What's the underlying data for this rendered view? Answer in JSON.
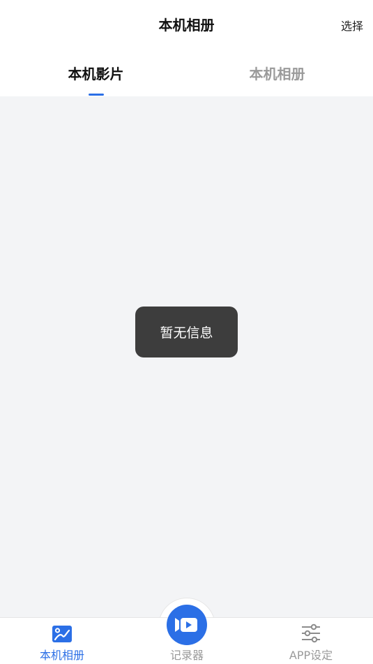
{
  "header": {
    "title": "本机相册",
    "action_label": "选择"
  },
  "tabs": [
    {
      "label": "本机影片",
      "active": true
    },
    {
      "label": "本机相册",
      "active": false
    }
  ],
  "content": {
    "empty_toast": "暂无信息"
  },
  "tabbar": {
    "items": [
      {
        "label": "本机相册",
        "icon": "album-icon",
        "active": true
      },
      {
        "label": "记录器",
        "icon": "recorder-video-icon",
        "active": false
      },
      {
        "label": "APP设定",
        "icon": "settings-sliders-icon",
        "active": false
      }
    ]
  },
  "colors": {
    "accent": "#2b6fe6",
    "inactive_text": "#9a9a9a",
    "content_bg": "#f3f4f6",
    "toast_bg": "#3d3d3d"
  }
}
